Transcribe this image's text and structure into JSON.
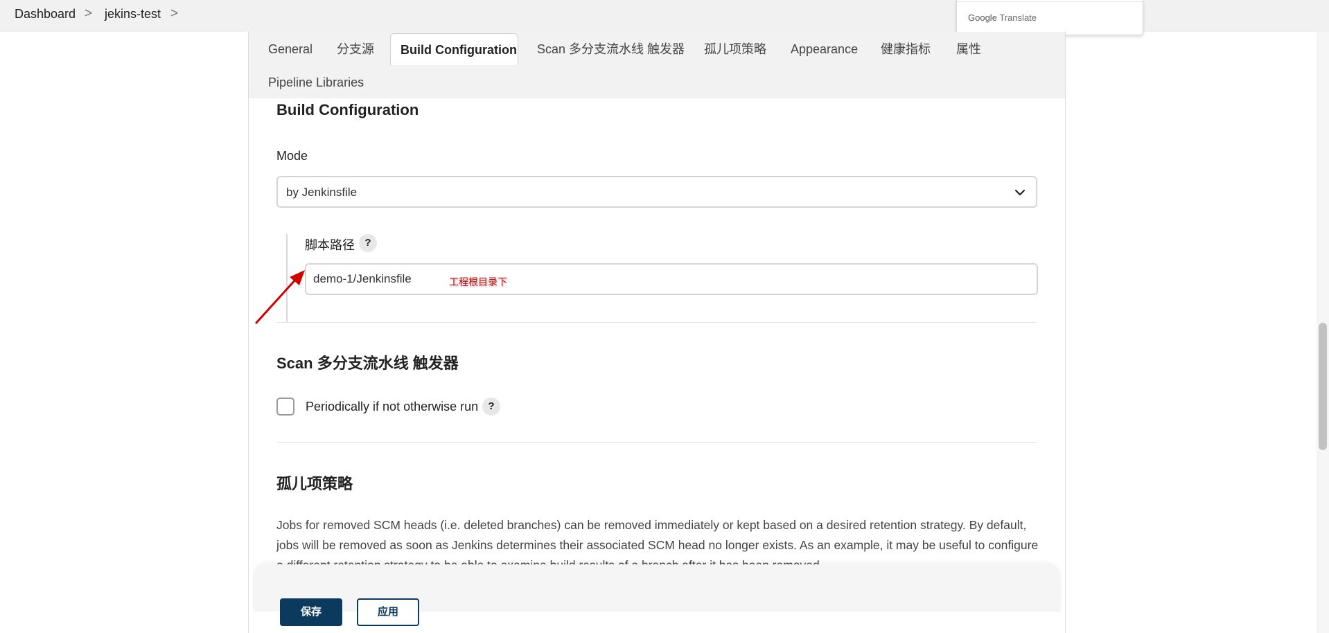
{
  "breadcrumb": {
    "items": [
      "Dashboard",
      "jekins-test"
    ],
    "separator": ">"
  },
  "translate_popup": {
    "google": "Google",
    "translate": "Translate"
  },
  "tabs": [
    {
      "label": "General"
    },
    {
      "label": "分支源"
    },
    {
      "label": "Build Configuration",
      "active": true
    },
    {
      "label": "Scan 多分支流水线 触发器"
    },
    {
      "label": "孤儿项策略"
    },
    {
      "label": "Appearance"
    },
    {
      "label": "健康指标"
    },
    {
      "label": "属性"
    },
    {
      "label": "Pipeline Libraries"
    }
  ],
  "build_config": {
    "title": "Build Configuration",
    "mode_label": "Mode",
    "mode_value": "by Jenkinsfile",
    "script_path_label": "脚本路径",
    "script_path_value": "demo-1/Jenkinsfile",
    "annotation": "工程根目录下",
    "help": "?"
  },
  "scan_triggers": {
    "title": "Scan 多分支流水线 触发器",
    "checkbox_label": "Periodically if not otherwise run",
    "checked": false,
    "help": "?"
  },
  "orphan": {
    "title": "孤儿项策略",
    "description": "Jobs for removed SCM heads (i.e. deleted branches) can be removed immediately or kept based on a desired retention strategy. By default, jobs will be removed as soon as Jenkins determines their associated SCM head no longer exists. As an example, it may be useful to configure a different retention strategy to be able to examine build results of a branch after it has been removed."
  },
  "footer": {
    "save": "保存",
    "apply": "应用"
  },
  "colors": {
    "primary": "#0b3a5e",
    "annotation_arrow": "#d40000"
  }
}
